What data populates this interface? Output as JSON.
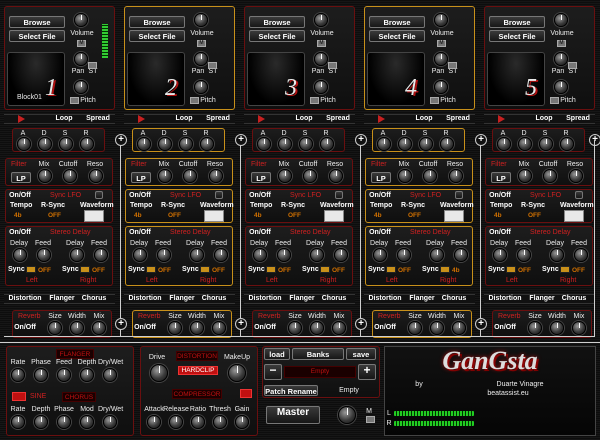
{
  "channels": [
    {
      "number": "1",
      "pad_name": "Block01",
      "highlight": false
    },
    {
      "number": "2",
      "pad_name": "",
      "highlight": true
    },
    {
      "number": "3",
      "pad_name": "",
      "highlight": false
    },
    {
      "number": "4",
      "pad_name": "",
      "highlight": true
    },
    {
      "number": "5",
      "pad_name": "",
      "highlight": false
    }
  ],
  "labels": {
    "browse": "Browse",
    "select_file": "Select File",
    "volume": "Volume",
    "pan": "Pan",
    "st": "ST",
    "pitch": "Pitch",
    "m": "M",
    "loop": "Loop",
    "spread": "Spread",
    "a": "A",
    "d": "D",
    "s": "S",
    "r": "R",
    "filter": "Filter",
    "lp": "LP",
    "mix": "Mix",
    "cutoff": "Cutoff",
    "reso": "Reso",
    "on_off": "On/Off",
    "sync_lfo": "Sync LFO",
    "tempo": "Tempo",
    "r_sync": "R-Sync",
    "waveform": "Waveform",
    "tempo_val": "4b",
    "off": "OFF",
    "stereo_delay": "Stereo Delay",
    "delay": "Delay",
    "feed": "Feed",
    "sync": "Sync",
    "left": "Left",
    "right": "Right",
    "delay_sync_val": "4b",
    "distortion": "Distortion",
    "flanger": "Flanger",
    "chorus": "Chorus",
    "reverb": "Reverb",
    "size": "Size",
    "width": "Width"
  },
  "master": {
    "flanger_title": "FLANGER",
    "flanger_knobs": [
      "Rate",
      "Phase",
      "Feed",
      "Depth",
      "Dry/Wet"
    ],
    "sine": "SINE",
    "chorus_title": "CHORUS",
    "chorus_knobs": [
      "Rate",
      "Depth",
      "Phase",
      "Mod",
      "Dry/Wet"
    ],
    "drive": "Drive",
    "distortion_title": "DISTORTION",
    "makeup": "MakeUp",
    "hardclip": "HARDCLIP",
    "compressor_title": "COMPRESSOR",
    "comp_knobs": [
      "Attack",
      "Release",
      "Ratio",
      "Thresh",
      "Gain"
    ],
    "load": "load",
    "banks": "Banks",
    "save": "save",
    "bank_value": "Empty",
    "minus": "−",
    "plus": "+",
    "patch_rename": "Patch Rename",
    "patch_value": "Empty",
    "master": "Master",
    "m": "M",
    "l": "L",
    "r": "R",
    "logo": "GanGsta",
    "by": "by",
    "author": "Duarte Vinagre",
    "site": "beatassist.eu",
    "meter_left": 0.42,
    "meter_right": 0.42
  }
}
